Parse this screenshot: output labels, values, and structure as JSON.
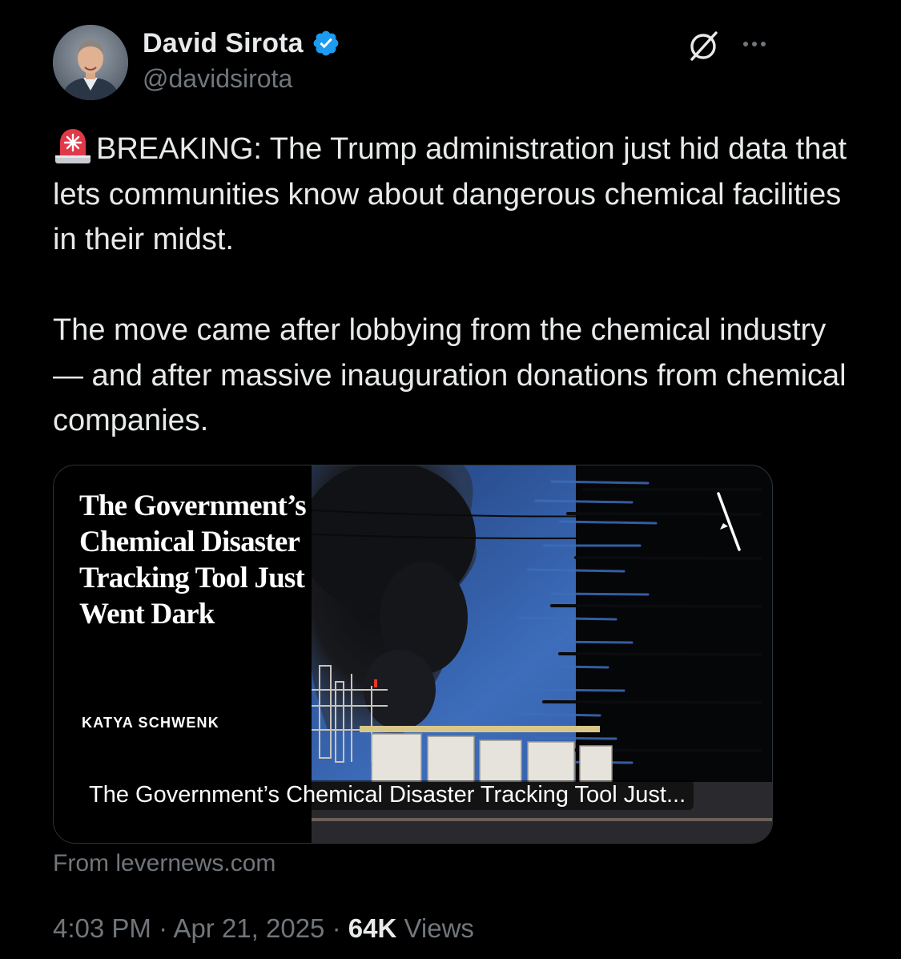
{
  "author": {
    "name": "David Sirota",
    "handle": "@davidsirota",
    "verified": true
  },
  "tweet": {
    "emoji": "rotating-light-siren",
    "paragraph1": "BREAKING: The Trump administration just hid data that lets communities know about dangerous chemical facilities in their midst.",
    "paragraph2": "The move came after lobbying from the chemical industry — and after massive inauguration donations from chemical companies."
  },
  "card": {
    "headline": "The Government’s Chemical Disaster Tracking Tool Just Went Dark",
    "author": "KATYA SCHWENK",
    "caption": "The Government’s Chemical Disaster Tracking Tool Just..."
  },
  "source": "From levernews.com",
  "meta": {
    "time": "4:03 PM",
    "separator": "·",
    "date": "Apr 21, 2025",
    "views_count": "64K",
    "views_label": "Views"
  },
  "colors": {
    "background": "#000000",
    "primary_text": "#e7e9ea",
    "secondary_text": "#71767b",
    "verified_blue": "#1d9bf0",
    "card_border": "#2f3336"
  },
  "icons": {
    "verified": "verified-badge-icon",
    "grok": "grok-icon",
    "more": "more-options-icon",
    "siren": "siren-icon"
  }
}
